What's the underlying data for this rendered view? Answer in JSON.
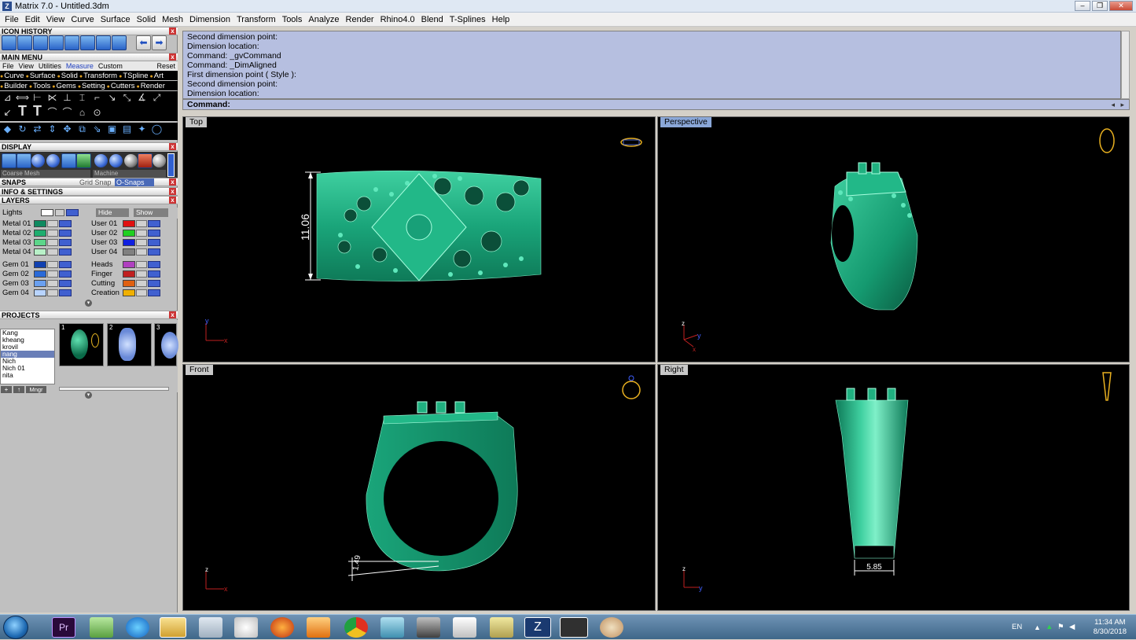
{
  "window": {
    "title": "Matrix 7.0 - Untitled.3dm",
    "buttons": [
      "–",
      "❐",
      "✕"
    ]
  },
  "menubar": [
    "File",
    "Edit",
    "View",
    "Curve",
    "Surface",
    "Solid",
    "Mesh",
    "Dimension",
    "Transform",
    "Tools",
    "Analyze",
    "Render",
    "Rhino4.0",
    "Blend",
    "T-Splines",
    "Help"
  ],
  "panels": {
    "icon_history": "ICON HISTORY",
    "main_menu": "MAIN MENU",
    "main_menu_tabs": [
      "File",
      "View",
      "Utilities",
      "Measure",
      "Custom",
      "Reset"
    ],
    "main_menu_active_tab": "Measure",
    "categories_row1": [
      "Curve",
      "Surface",
      "Solid",
      "Transform",
      "TSpline",
      "Art"
    ],
    "categories_row2": [
      "Builder",
      "Tools",
      "Gems",
      "Setting",
      "Cutters",
      "Render"
    ],
    "display": "DISPLAY",
    "display_mesh": "Coarse Mesh",
    "display_mode": "Machine",
    "snaps": "SNAPS",
    "grid_snap": "Grid Snap",
    "o_snaps": "O-Snaps",
    "info_settings": "INFO & SETTINGS",
    "layers": "LAYERS",
    "lights": "Lights",
    "hide": "Hide",
    "show": "Show",
    "projects": "PROJECTS",
    "mngr": "Mngr"
  },
  "layers_left": [
    {
      "name": "Metal 01",
      "color": "#0f8a60"
    },
    {
      "name": "Metal 02",
      "color": "#1fae6f"
    },
    {
      "name": "Metal 03",
      "color": "#5cd68a"
    },
    {
      "name": "Metal 04",
      "color": "#b8f0c8"
    },
    {
      "name": "Gem 01",
      "color": "#1040b0"
    },
    {
      "name": "Gem 02",
      "color": "#2a6ad8"
    },
    {
      "name": "Gem 03",
      "color": "#6aa0f0"
    },
    {
      "name": "Gem 04",
      "color": "#b8d4ff"
    }
  ],
  "layers_right": [
    {
      "name": "User 01",
      "color": "#e01010"
    },
    {
      "name": "User 02",
      "color": "#20d020"
    },
    {
      "name": "User 03",
      "color": "#1020e0"
    },
    {
      "name": "User 04",
      "color": "#808080"
    },
    {
      "name": "Heads",
      "color": "#b040c0"
    },
    {
      "name": "Finger",
      "color": "#c02020"
    },
    {
      "name": "Cutting",
      "color": "#e06010"
    },
    {
      "name": "Creation",
      "color": "#f0b000"
    }
  ],
  "projects_list": [
    "Kang",
    "kheang",
    "krovil",
    "nang",
    "Nich",
    "Nich 01",
    "nita"
  ],
  "projects_selected": "nang",
  "project_thumbs": [
    "1",
    "2",
    "3"
  ],
  "command_history": [
    "Second dimension point:",
    "Dimension location:",
    "Command: _gvCommand",
    "Command: _DimAligned",
    "First dimension point ( Style ):",
    "Second dimension point:",
    "Dimension location:"
  ],
  "command_prompt": "Command:",
  "viewports": {
    "top": {
      "label": "Top",
      "dimension": "11.06",
      "axis_a": "y",
      "axis_b": "x"
    },
    "perspective": {
      "label": "Perspective",
      "axis_a": "z",
      "axis_b": "y",
      "axis_c": "x"
    },
    "front": {
      "label": "Front",
      "dimension": "1.49",
      "axis_a": "z",
      "axis_b": "x"
    },
    "right": {
      "label": "Right",
      "dimension": "5.85",
      "axis_a": "z",
      "axis_b": "y"
    }
  },
  "model_color": "#1f9a72",
  "taskbar": {
    "language": "EN",
    "time": "11:34 AM",
    "date": "8/30/2018"
  }
}
